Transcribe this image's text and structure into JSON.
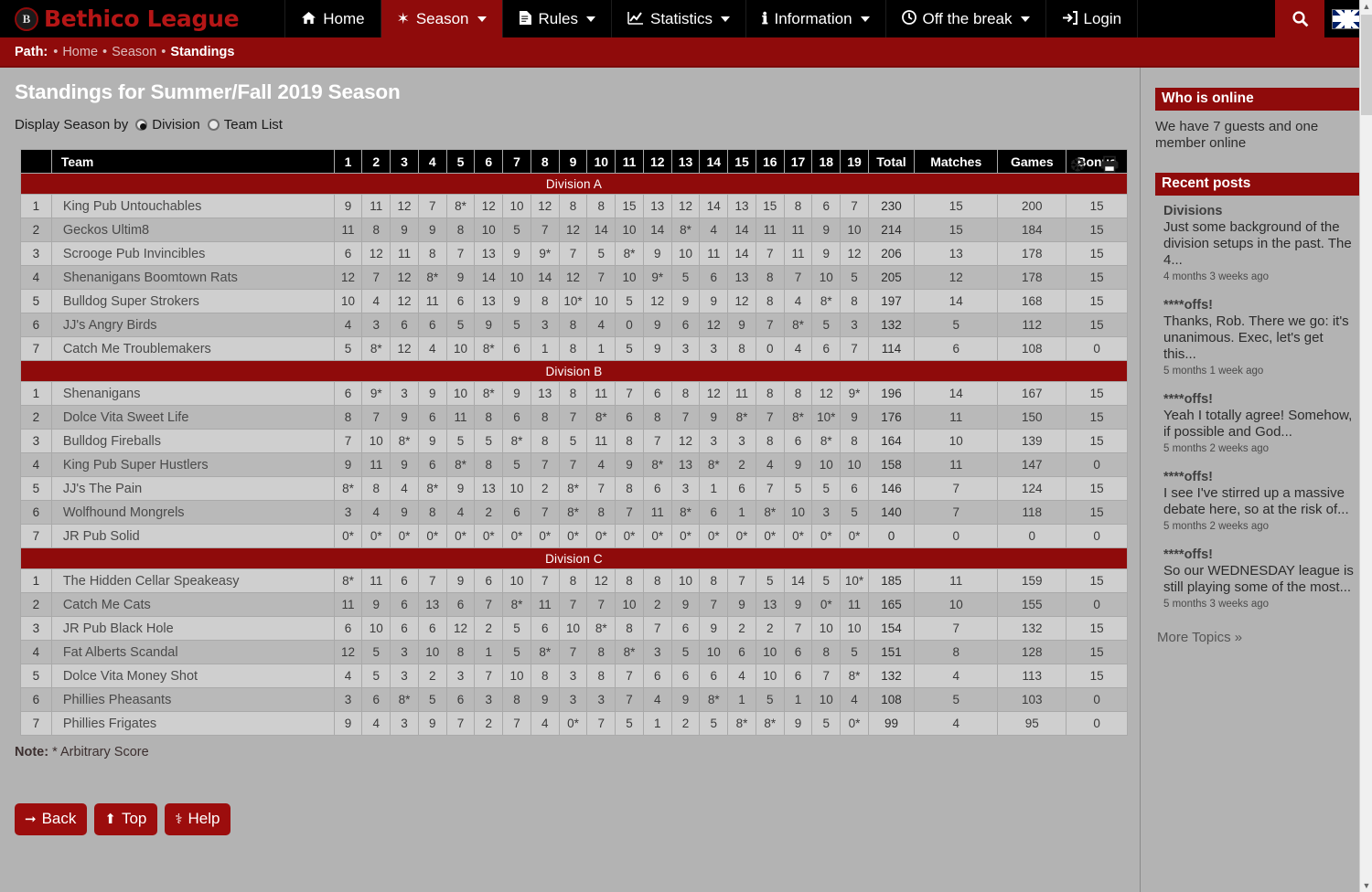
{
  "brand": {
    "logo_letter": "B",
    "name": "Bethico League"
  },
  "nav": {
    "items": [
      {
        "label": "Home",
        "icon": "home-icon",
        "glyph": "⌂",
        "caret": false,
        "active": false
      },
      {
        "label": "Season",
        "icon": "snowflake-icon",
        "glyph": "❅",
        "caret": true,
        "active": true
      },
      {
        "label": "Rules",
        "icon": "document-icon",
        "glyph": "὜F",
        "caret": true,
        "active": false
      },
      {
        "label": "Statistics",
        "icon": "chart-line-icon",
        "glyph": "↗",
        "caret": true,
        "active": false
      },
      {
        "label": "Information",
        "icon": "info-icon",
        "glyph": "ℹ",
        "caret": true,
        "active": false
      },
      {
        "label": "Off the break",
        "icon": "clock-icon",
        "glyph": "◕",
        "caret": true,
        "active": false
      },
      {
        "label": "Login",
        "icon": "login-icon",
        "glyph": "→]",
        "caret": false,
        "active": false
      }
    ],
    "search_icon": "search-icon",
    "search_glyph": "⚲",
    "flag_icon": "uk-flag-icon"
  },
  "breadcrumb": {
    "label": "Path:",
    "items": [
      "Home",
      "Season",
      "Standings"
    ]
  },
  "header": {
    "title": "Standings for Summer/Fall 2019 Season",
    "icons": [
      {
        "name": "snowflake-icon",
        "glyph": "❆"
      },
      {
        "name": "print-icon",
        "glyph": "⎙"
      }
    ]
  },
  "display_by": {
    "label": "Display Season by",
    "options": [
      {
        "label": "Division",
        "selected": true
      },
      {
        "label": "Team List",
        "selected": false
      }
    ]
  },
  "table": {
    "columns": [
      "",
      "Team",
      "1",
      "2",
      "3",
      "4",
      "5",
      "6",
      "7",
      "8",
      "9",
      "10",
      "11",
      "12",
      "13",
      "14",
      "15",
      "16",
      "17",
      "18",
      "19",
      "Total",
      "Matches",
      "Games",
      "Bonus"
    ],
    "divisions": [
      {
        "name": "Division A",
        "rows": [
          {
            "rank": "1",
            "team": "King Pub Untouchables",
            "scores": [
              "9",
              "11",
              "12",
              "7",
              "8*",
              "12",
              "10",
              "12",
              "8",
              "8",
              "15",
              "13",
              "12",
              "14",
              "13",
              "15",
              "8",
              "6",
              "7"
            ],
            "total": "230",
            "matches": "15",
            "games": "200",
            "bonus": "15"
          },
          {
            "rank": "2",
            "team": "Geckos Ultim8",
            "scores": [
              "11",
              "8",
              "9",
              "9",
              "8",
              "10",
              "5",
              "7",
              "12",
              "14",
              "10",
              "14",
              "8*",
              "4",
              "14",
              "11",
              "11",
              "9",
              "10"
            ],
            "total": "214",
            "matches": "15",
            "games": "184",
            "bonus": "15"
          },
          {
            "rank": "3",
            "team": "Scrooge Pub Invincibles",
            "scores": [
              "6",
              "12",
              "11",
              "8",
              "7",
              "13",
              "9",
              "9*",
              "7",
              "5",
              "8*",
              "9",
              "10",
              "11",
              "14",
              "7",
              "11",
              "9",
              "12"
            ],
            "total": "206",
            "matches": "13",
            "games": "178",
            "bonus": "15"
          },
          {
            "rank": "4",
            "team": "Shenanigans Boomtown Rats",
            "scores": [
              "12",
              "7",
              "12",
              "8*",
              "9",
              "14",
              "10",
              "14",
              "12",
              "7",
              "10",
              "9*",
              "5",
              "6",
              "13",
              "8",
              "7",
              "10",
              "5"
            ],
            "total": "205",
            "matches": "12",
            "games": "178",
            "bonus": "15"
          },
          {
            "rank": "5",
            "team": "Bulldog Super Strokers",
            "scores": [
              "10",
              "4",
              "12",
              "11",
              "6",
              "13",
              "9",
              "8",
              "10*",
              "10",
              "5",
              "12",
              "9",
              "9",
              "12",
              "8",
              "4",
              "8*",
              "8"
            ],
            "total": "197",
            "matches": "14",
            "games": "168",
            "bonus": "15"
          },
          {
            "rank": "6",
            "team": "JJ's Angry Birds",
            "scores": [
              "4",
              "3",
              "6",
              "6",
              "5",
              "9",
              "5",
              "3",
              "8",
              "4",
              "0",
              "9",
              "6",
              "12",
              "9",
              "7",
              "8*",
              "5",
              "3"
            ],
            "total": "132",
            "matches": "5",
            "games": "112",
            "bonus": "15"
          },
          {
            "rank": "7",
            "team": "Catch Me Troublemakers",
            "scores": [
              "5",
              "8*",
              "12",
              "4",
              "10",
              "8*",
              "6",
              "1",
              "8",
              "1",
              "5",
              "9",
              "3",
              "3",
              "8",
              "0",
              "4",
              "6",
              "7"
            ],
            "total": "114",
            "matches": "6",
            "games": "108",
            "bonus": "0"
          }
        ]
      },
      {
        "name": "Division B",
        "rows": [
          {
            "rank": "1",
            "team": "Shenanigans",
            "scores": [
              "6",
              "9*",
              "3",
              "9",
              "10",
              "8*",
              "9",
              "13",
              "8",
              "11",
              "7",
              "6",
              "8",
              "12",
              "11",
              "8",
              "8",
              "12",
              "9*"
            ],
            "total": "196",
            "matches": "14",
            "games": "167",
            "bonus": "15"
          },
          {
            "rank": "2",
            "team": "Dolce Vita Sweet Life",
            "scores": [
              "8",
              "7",
              "9",
              "6",
              "11",
              "8",
              "6",
              "8",
              "7",
              "8*",
              "6",
              "8",
              "7",
              "9",
              "8*",
              "7",
              "8*",
              "10*",
              "9"
            ],
            "total": "176",
            "matches": "11",
            "games": "150",
            "bonus": "15"
          },
          {
            "rank": "3",
            "team": "Bulldog Fireballs",
            "scores": [
              "7",
              "10",
              "8*",
              "9",
              "5",
              "5",
              "8*",
              "8",
              "5",
              "11",
              "8",
              "7",
              "12",
              "3",
              "3",
              "8",
              "6",
              "8*",
              "8"
            ],
            "total": "164",
            "matches": "10",
            "games": "139",
            "bonus": "15"
          },
          {
            "rank": "4",
            "team": "King Pub Super Hustlers",
            "scores": [
              "9",
              "11",
              "9",
              "6",
              "8*",
              "8",
              "5",
              "7",
              "7",
              "4",
              "9",
              "8*",
              "13",
              "8*",
              "2",
              "4",
              "9",
              "10",
              "10"
            ],
            "total": "158",
            "matches": "11",
            "games": "147",
            "bonus": "0"
          },
          {
            "rank": "5",
            "team": "JJ's The Pain",
            "scores": [
              "8*",
              "8",
              "4",
              "8*",
              "9",
              "13",
              "10",
              "2",
              "8*",
              "7",
              "8",
              "6",
              "3",
              "1",
              "6",
              "7",
              "5",
              "5",
              "6"
            ],
            "total": "146",
            "matches": "7",
            "games": "124",
            "bonus": "15"
          },
          {
            "rank": "6",
            "team": "Wolfhound Mongrels",
            "scores": [
              "3",
              "4",
              "9",
              "8",
              "4",
              "2",
              "6",
              "7",
              "8*",
              "8",
              "7",
              "11",
              "8*",
              "6",
              "1",
              "8*",
              "10",
              "3",
              "5"
            ],
            "total": "140",
            "matches": "7",
            "games": "118",
            "bonus": "15"
          },
          {
            "rank": "7",
            "team": "JR Pub Solid",
            "scores": [
              "0*",
              "0*",
              "0*",
              "0*",
              "0*",
              "0*",
              "0*",
              "0*",
              "0*",
              "0*",
              "0*",
              "0*",
              "0*",
              "0*",
              "0*",
              "0*",
              "0*",
              "0*",
              "0*"
            ],
            "total": "0",
            "matches": "0",
            "games": "0",
            "bonus": "0"
          }
        ]
      },
      {
        "name": "Division C",
        "rows": [
          {
            "rank": "1",
            "team": "The Hidden Cellar Speakeasy",
            "scores": [
              "8*",
              "11",
              "6",
              "7",
              "9",
              "6",
              "10",
              "7",
              "8",
              "12",
              "8",
              "8",
              "10",
              "8",
              "7",
              "5",
              "14",
              "5",
              "10*"
            ],
            "total": "185",
            "matches": "11",
            "games": "159",
            "bonus": "15"
          },
          {
            "rank": "2",
            "team": "Catch Me Cats",
            "scores": [
              "11",
              "9",
              "6",
              "13",
              "6",
              "7",
              "8*",
              "11",
              "7",
              "7",
              "10",
              "2",
              "9",
              "7",
              "9",
              "13",
              "9",
              "0*",
              "11"
            ],
            "total": "165",
            "matches": "10",
            "games": "155",
            "bonus": "0"
          },
          {
            "rank": "3",
            "team": "JR Pub Black Hole",
            "scores": [
              "6",
              "10",
              "6",
              "6",
              "12",
              "2",
              "5",
              "6",
              "10",
              "8*",
              "8",
              "7",
              "6",
              "9",
              "2",
              "2",
              "7",
              "10",
              "10"
            ],
            "total": "154",
            "matches": "7",
            "games": "132",
            "bonus": "15"
          },
          {
            "rank": "4",
            "team": "Fat Alberts Scandal",
            "scores": [
              "12",
              "5",
              "3",
              "10",
              "8",
              "1",
              "5",
              "8*",
              "7",
              "8",
              "8*",
              "3",
              "5",
              "10",
              "6",
              "10",
              "6",
              "8",
              "5"
            ],
            "total": "151",
            "matches": "8",
            "games": "128",
            "bonus": "15"
          },
          {
            "rank": "5",
            "team": "Dolce Vita Money Shot",
            "scores": [
              "4",
              "5",
              "3",
              "2",
              "3",
              "7",
              "10",
              "8",
              "3",
              "8",
              "7",
              "6",
              "6",
              "6",
              "4",
              "10",
              "6",
              "7",
              "8*"
            ],
            "total": "132",
            "matches": "4",
            "games": "113",
            "bonus": "15"
          },
          {
            "rank": "6",
            "team": "Phillies Pheasants",
            "scores": [
              "3",
              "6",
              "8*",
              "5",
              "6",
              "3",
              "8",
              "9",
              "3",
              "3",
              "7",
              "4",
              "9",
              "8*",
              "1",
              "5",
              "1",
              "10",
              "4"
            ],
            "total": "108",
            "matches": "5",
            "games": "103",
            "bonus": "0"
          },
          {
            "rank": "7",
            "team": "Phillies Frigates",
            "scores": [
              "9",
              "4",
              "3",
              "9",
              "7",
              "2",
              "7",
              "4",
              "0*",
              "7",
              "5",
              "1",
              "2",
              "5",
              "8*",
              "8*",
              "9",
              "5",
              "0*"
            ],
            "total": "99",
            "matches": "4",
            "games": "95",
            "bonus": "0"
          }
        ]
      }
    ]
  },
  "note": {
    "prefix": "Note:",
    "text": "* Arbitrary Score"
  },
  "buttons": [
    {
      "label": "Back",
      "icon": "arrow-left-icon",
      "glyph": "←"
    },
    {
      "label": "Top",
      "icon": "arrow-up-icon",
      "glyph": "↑"
    },
    {
      "label": "Help",
      "icon": "medkit-icon",
      "glyph": "⊕"
    }
  ],
  "sidebar": {
    "who_online": {
      "heading": "Who is online",
      "text": "We have 7 guests and one member online"
    },
    "recent_posts": {
      "heading": "Recent posts",
      "posts": [
        {
          "title": "Divisions",
          "body": "Just some background of the division setups in the past. The 4...",
          "date": "4 months 3 weeks ago"
        },
        {
          "title": "****offs!",
          "body": "Thanks, Rob. There we go: it's unanimous. Exec, let's get this...",
          "date": "5 months 1 week ago"
        },
        {
          "title": "****offs!",
          "body": "Yeah I totally agree! Somehow, if possible and God...",
          "date": "5 months 2 weeks ago"
        },
        {
          "title": "****offs!",
          "body": "I see I've stirred up a massive debate here, so at the risk of...",
          "date": "5 months 2 weeks ago"
        },
        {
          "title": "****offs!",
          "body": "So our WEDNESDAY league is still playing some of the most...",
          "date": "5 months 3 weeks ago"
        }
      ],
      "more": "More Topics »"
    }
  },
  "colors": {
    "brand_red": "#8f0b0b",
    "accent_red": "#b51616",
    "page_bg": "#b3b3b3"
  }
}
